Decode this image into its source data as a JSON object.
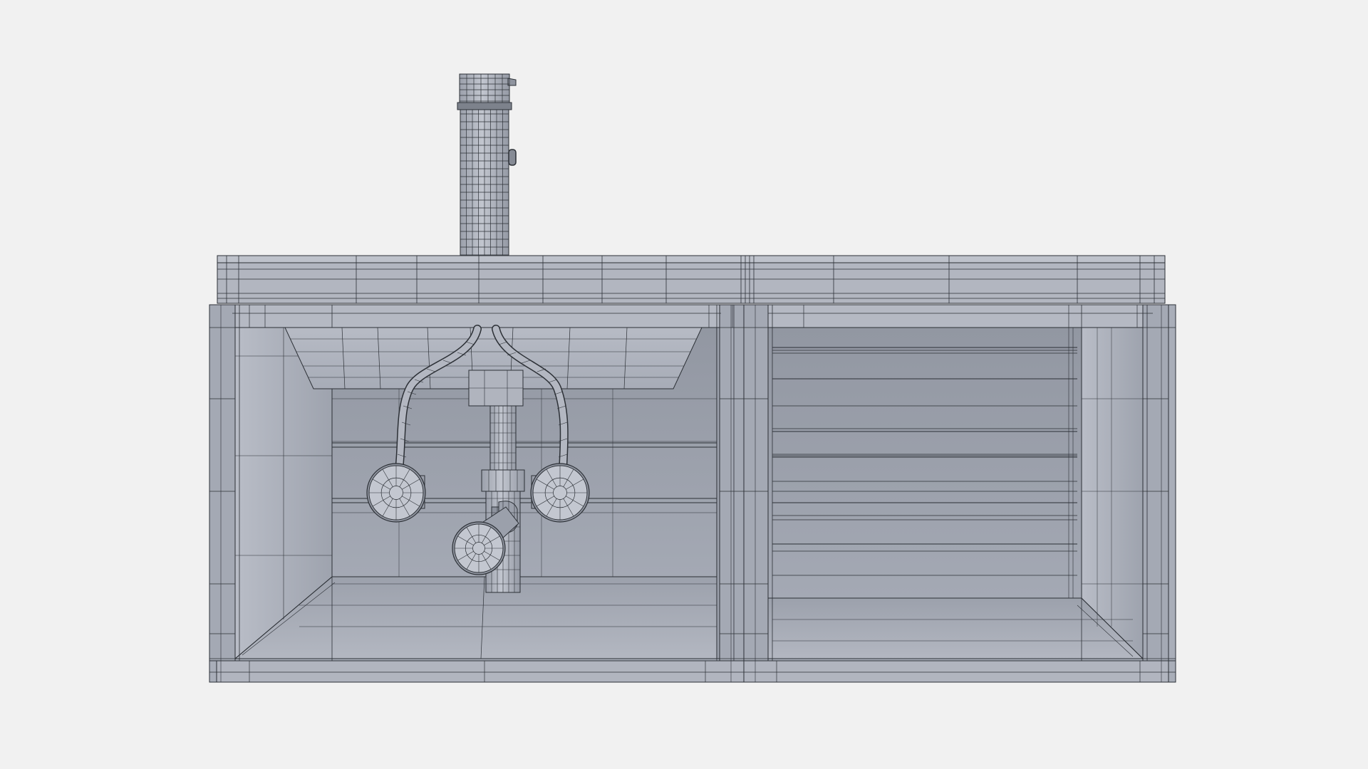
{
  "scene": {
    "subject": "wireframe-vanity-unit",
    "background_color": "#f1f1f1",
    "surface_color": "#a3a8b4",
    "surface_light": "#b8bcc6",
    "surface_dark": "#8f949f",
    "wire_color": "#2c3036",
    "components": [
      "countertop",
      "faucet",
      "left-cabinet",
      "right-cabinet",
      "basin",
      "supply-hoses",
      "shutoff-valves",
      "bottle-trap",
      "drawer-slats"
    ]
  }
}
